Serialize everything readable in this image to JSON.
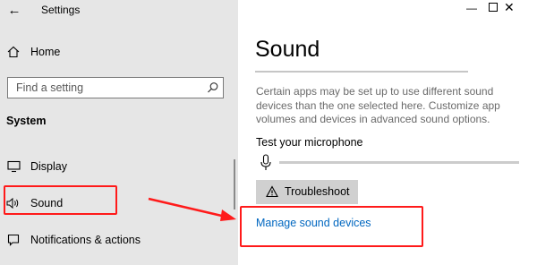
{
  "app": {
    "title": "Settings"
  },
  "nav": {
    "home_label": "Home",
    "search_placeholder": "Find a setting",
    "section_label": "System",
    "items": [
      {
        "label": "Display",
        "icon": "display-icon"
      },
      {
        "label": "Sound",
        "icon": "speaker-icon",
        "highlighted": true
      },
      {
        "label": "Notifications & actions",
        "icon": "notifications-icon"
      }
    ]
  },
  "content": {
    "title": "Sound",
    "description": "Certain apps may be set up to use different sound devices than the one selected here. Customize app volumes and devices in advanced sound options.",
    "mic_label": "Test your microphone",
    "mic_level": 0,
    "troubleshoot_label": "Troubleshoot",
    "manage_link": "Manage sound devices"
  },
  "colors": {
    "nav_bg": "#e6e6e6",
    "link": "#0067c0",
    "annotation": "#ff1a1a"
  }
}
